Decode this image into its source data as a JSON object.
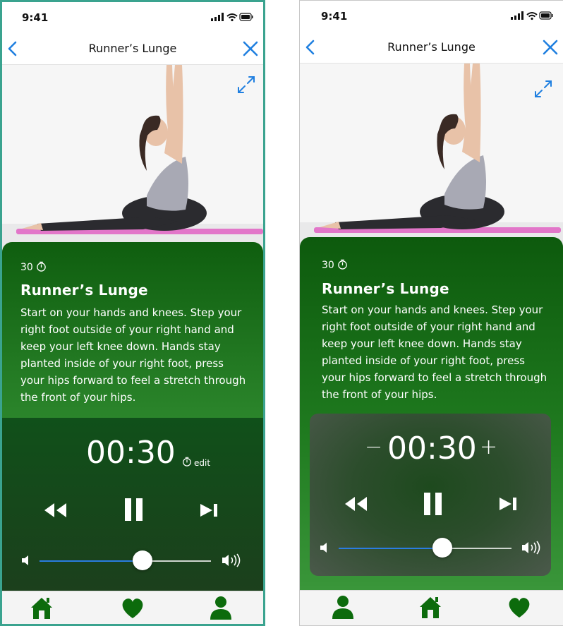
{
  "colors": {
    "icon_blue": "#1f7fe0",
    "green_dark": "#0e5a0e",
    "green_mid": "#2f8a2f",
    "tab_green": "#0c6b0c",
    "slider_blue": "#2a7de1"
  },
  "screens": [
    {
      "status": {
        "time": "9:41"
      },
      "nav": {
        "title": "Runner’s Lunge",
        "back_icon": "chevron-left",
        "close_icon": "x"
      },
      "exercise": {
        "duration": "30",
        "title": "Runner’s Lunge",
        "description": "Start on your hands and knees. Step your right foot outside of your right hand and keep your left knee down. Hands stay planted inside of your right foot, press your hips forward to feel a stretch through the front of your hips."
      },
      "player": {
        "time": "00:30",
        "edit_label": "edit",
        "volume_fraction": 0.6
      },
      "tabs": [
        "home-icon",
        "heart-icon",
        "user-icon"
      ]
    },
    {
      "status": {
        "time": "9:41"
      },
      "nav": {
        "title": "Runner’s Lunge",
        "back_icon": "chevron-left",
        "close_icon": "x"
      },
      "exercise": {
        "duration": "30",
        "title": "Runner’s Lunge",
        "description": "Start on your hands and knees. Step your right foot outside of your right hand and keep your left knee down. Hands stay planted inside of your right foot, press your hips forward to feel a stretch through the front of your hips."
      },
      "player": {
        "time": "00:30",
        "minus_label": "−",
        "plus_label": "+",
        "volume_fraction": 0.6
      },
      "tabs": [
        "user-icon",
        "home-icon",
        "heart-icon"
      ]
    }
  ]
}
